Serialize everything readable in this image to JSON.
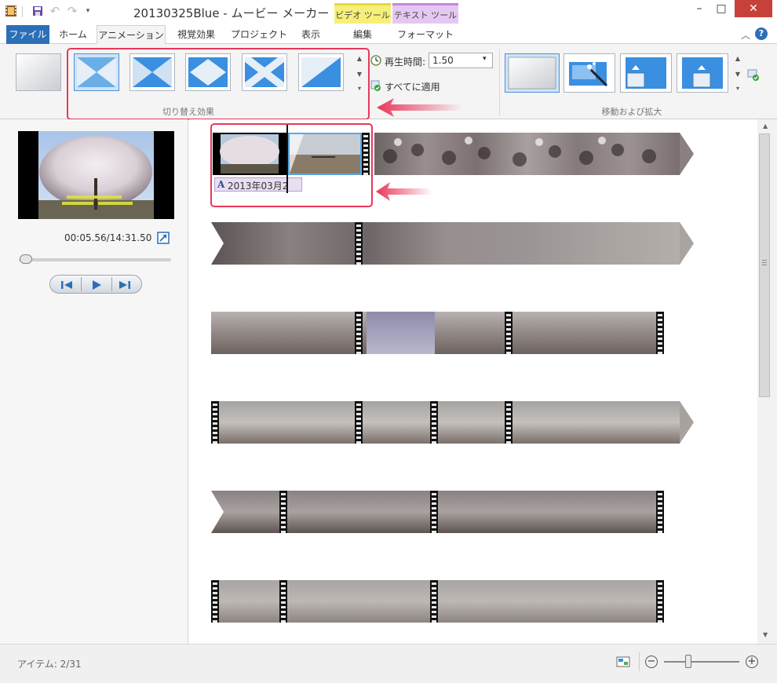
{
  "window": {
    "title": "20130325Blue - ムービー メーカー",
    "context_tabs": [
      "ビデオ ツール",
      "テキスト ツール"
    ]
  },
  "ribbon": {
    "tabs": [
      "ファイル",
      "ホーム",
      "アニメーション",
      "視覚効果",
      "プロジェクト",
      "表示",
      "編集",
      "フォーマット"
    ],
    "active_tab": "アニメーション",
    "transitions_group_label": "切り替え効果",
    "pan_zoom_group_label": "移動および拡大",
    "duration_label": "再生時間:",
    "duration_value": "1.50",
    "apply_all_label": "すべてに適用"
  },
  "preview": {
    "timecode": "00:05.56/14:31.50",
    "position_fraction": 0.006
  },
  "storyboard": {
    "caption_text": "2013年03月2"
  },
  "status": {
    "items_text": "アイテム: 2/31"
  },
  "colors": {
    "accent": "#2b6fb7",
    "highlight": "#e8375a",
    "selection": "#4e90d8"
  }
}
